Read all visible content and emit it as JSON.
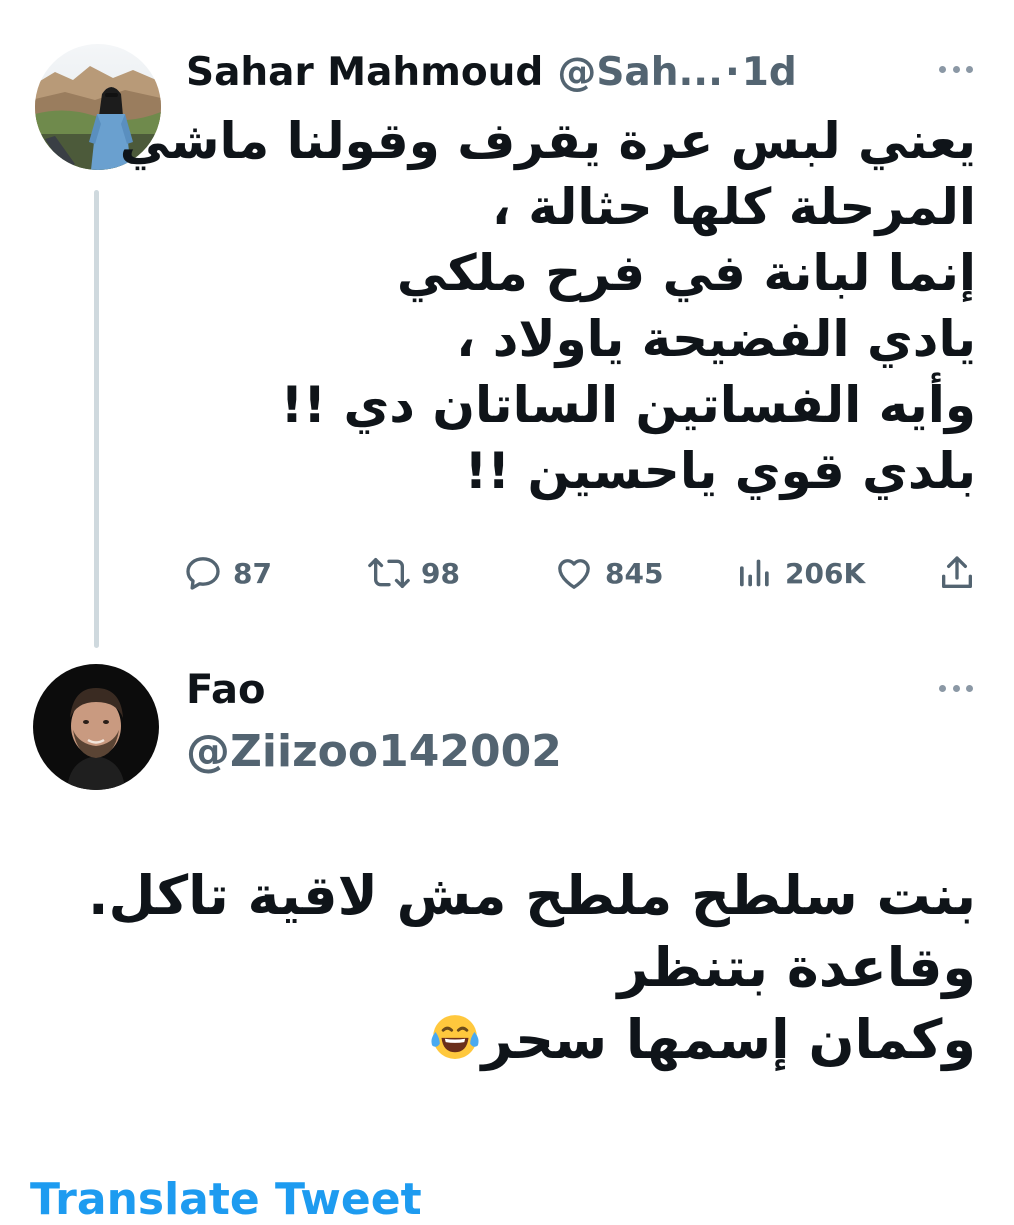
{
  "tweet": {
    "author_name": "Sahar Mahmoud",
    "author_handle": "@Sah...",
    "separator": "·",
    "time": "1d",
    "text_lines": [
      "يعني لبس عرة يقرف وقولنا ماشي",
      "المرحلة كلها حثالة ،",
      "إنما لبانة في فرح ملكي",
      "يادي الفضيحة ياولاد ،",
      "وأيه الفساتين الساتان دي !!",
      "بلدي قوي ياحسين !!"
    ],
    "replies": "87",
    "retweets": "98",
    "likes": "845",
    "views": "206K"
  },
  "reply": {
    "author_name": "Fao",
    "author_handle": "@Ziizoo142002",
    "text_lines": [
      "بنت سلطح ملطح مش لاقية تاكل.",
      "وقاعدة  بتنظر",
      "وكمان إسمها سحر"
    ],
    "emoji": "face-with-tears-of-joy"
  },
  "footer": {
    "translate_link": "Translate Tweet"
  },
  "colors": {
    "text_primary": "#0f1419",
    "text_secondary": "#536471",
    "accent": "#1d9bf0",
    "thread_line": "#cfd9de"
  }
}
